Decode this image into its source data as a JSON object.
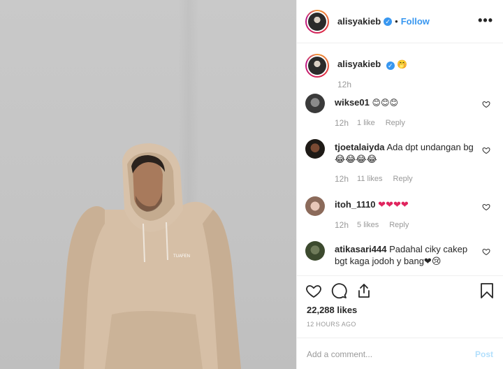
{
  "post": {
    "author": "alisyakieb",
    "follow_label": "Follow",
    "separator": "•",
    "more_label": "•••",
    "logo_text": "TUAFEN"
  },
  "caption": {
    "username": "alisyakieb",
    "emoji": "🤭",
    "time": "12h"
  },
  "comments": [
    {
      "username": "wikse01",
      "text": "😊😊😊",
      "time": "12h",
      "likes": "1 like",
      "reply": "Reply"
    },
    {
      "username": "tjoetalaiyda",
      "text": "Ada dpt undangan bg😂😂😂😂",
      "time": "12h",
      "likes": "11 likes",
      "reply": "Reply"
    },
    {
      "username": "itoh_1110",
      "text": "❤❤❤❤",
      "time": "12h",
      "likes": "5 likes",
      "reply": "Reply"
    },
    {
      "username": "atikasari444",
      "text": "Padahal ciky cakep bgt kaga jodoh y bang❤😢",
      "time": "",
      "likes": "",
      "reply": ""
    }
  ],
  "footer": {
    "likes": "22,288 likes",
    "posted": "12 HOURS AGO",
    "comment_placeholder": "Add a comment...",
    "post_label": "Post"
  },
  "colors": {
    "accent": "#3897f0",
    "heart": "#e0245e",
    "post_disabled": "#b2dffc"
  }
}
